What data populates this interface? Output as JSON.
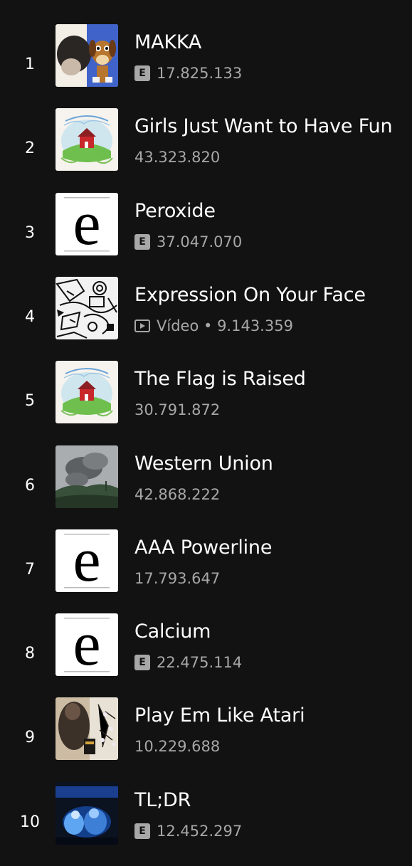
{
  "tracks": [
    {
      "rank": "1",
      "title": "MAKKA",
      "explicit": true,
      "video": false,
      "video_label": "",
      "plays": "17.825.133",
      "cover": "dog"
    },
    {
      "rank": "2",
      "title": "Girls Just Want to Have Fun",
      "explicit": false,
      "video": false,
      "video_label": "",
      "plays": "43.323.820",
      "cover": "barn"
    },
    {
      "rank": "3",
      "title": "Peroxide",
      "explicit": true,
      "video": false,
      "video_label": "",
      "plays": "37.047.070",
      "cover": "e"
    },
    {
      "rank": "4",
      "title": "Expression On Your Face",
      "explicit": false,
      "video": true,
      "video_label": "Vídeo",
      "plays": "9.143.359",
      "cover": "sketch"
    },
    {
      "rank": "5",
      "title": "The Flag is Raised",
      "explicit": false,
      "video": false,
      "video_label": "",
      "plays": "30.791.872",
      "cover": "barn"
    },
    {
      "rank": "6",
      "title": "Western Union",
      "explicit": false,
      "video": false,
      "video_label": "",
      "plays": "42.868.222",
      "cover": "smoke"
    },
    {
      "rank": "7",
      "title": "AAA Powerline",
      "explicit": false,
      "video": false,
      "video_label": "",
      "plays": "17.793.647",
      "cover": "e"
    },
    {
      "rank": "8",
      "title": "Calcium",
      "explicit": true,
      "video": false,
      "video_label": "",
      "plays": "22.475.114",
      "cover": "e"
    },
    {
      "rank": "9",
      "title": "Play Em Like Atari",
      "explicit": false,
      "video": false,
      "video_label": "",
      "plays": "10.229.688",
      "cover": "photo"
    },
    {
      "rank": "10",
      "title": "TL;DR",
      "explicit": true,
      "video": false,
      "video_label": "",
      "plays": "12.452.297",
      "cover": "blue"
    }
  ],
  "explicit_label": "E",
  "separator": " • ",
  "colors": {
    "background": "#121212",
    "primary_text": "#ffffff",
    "secondary_text": "#a7a7a7"
  },
  "icons": {
    "explicit": "explicit-badge-icon",
    "video": "video-play-icon"
  }
}
